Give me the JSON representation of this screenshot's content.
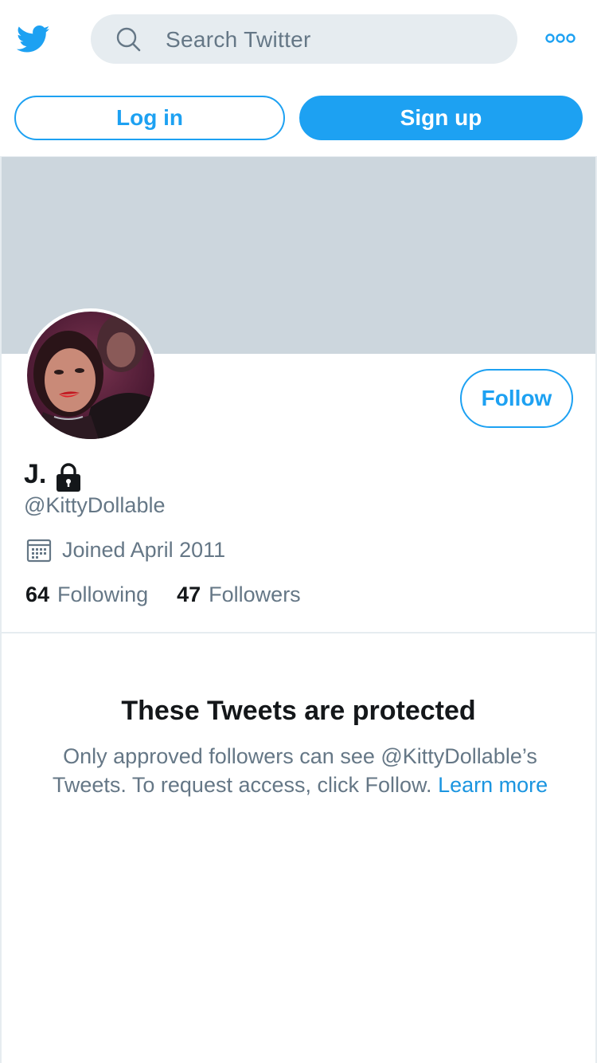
{
  "header": {
    "logo_icon": "twitter-bird-icon",
    "search_placeholder": "Search Twitter",
    "more_icon": "more-options-icon"
  },
  "auth": {
    "login_label": "Log in",
    "signup_label": "Sign up"
  },
  "profile": {
    "name": "J.",
    "handle": "@KittyDollable",
    "joined": "Joined April 2011",
    "follow_label": "Follow",
    "following_count": "64",
    "following_label": "Following",
    "followers_count": "47",
    "followers_label": "Followers",
    "protected_icon": "lock-icon"
  },
  "protected": {
    "title": "These Tweets are protected",
    "body_line1": "Only approved followers can see @KittyDollable’s",
    "body_line2": "Tweets. To request access, click Follow.",
    "learn_more": "Learn more"
  },
  "colors": {
    "accent": "#1da1f2",
    "banner": "#ccd6dd",
    "search_bg": "#e6ecf0",
    "secondary_text": "#657786"
  }
}
